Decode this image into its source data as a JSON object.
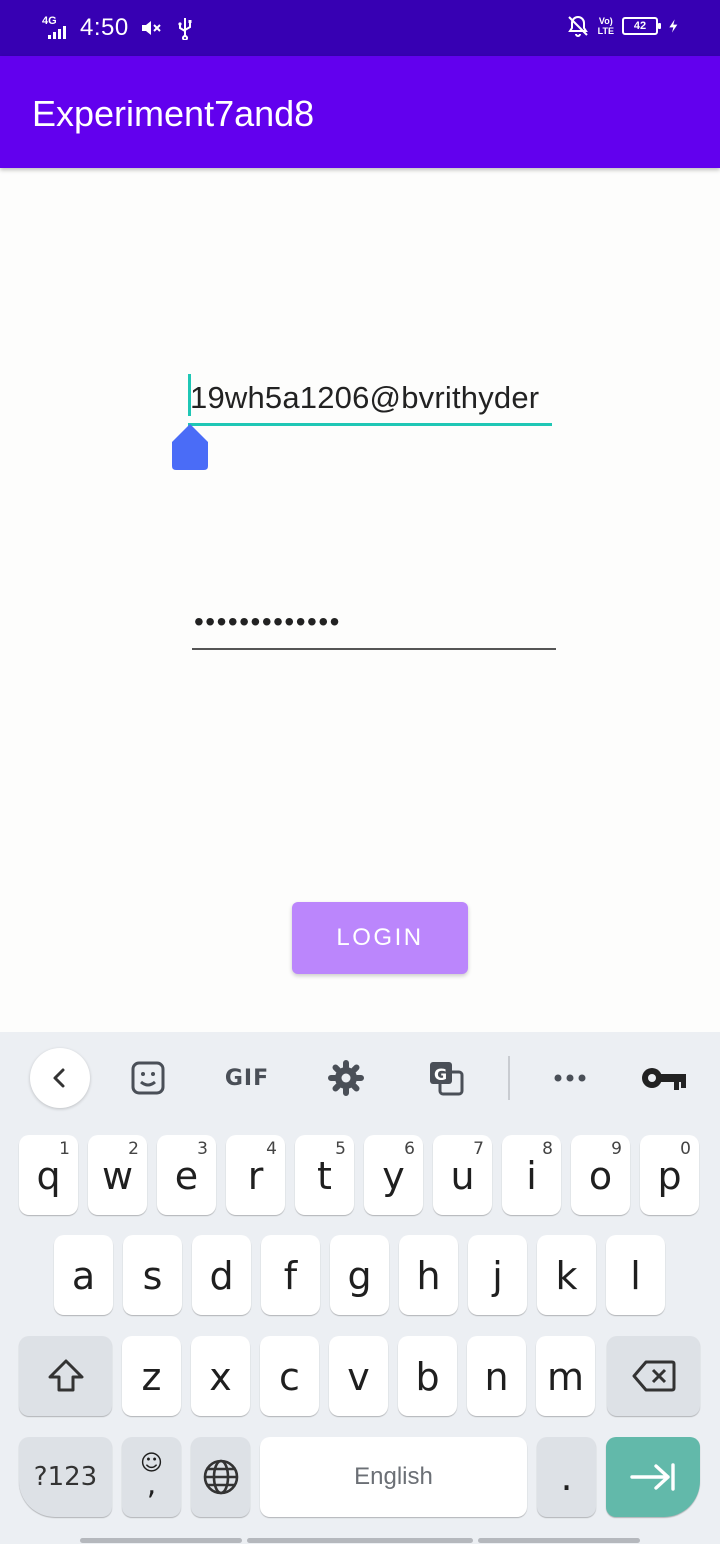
{
  "status_bar": {
    "network_type": "4G",
    "time": "4:50",
    "battery_level": "42",
    "volte_label_top": "Vo)",
    "volte_label_bottom": "LTE"
  },
  "app_bar": {
    "title": "Experiment7and8"
  },
  "form": {
    "email_value": "19wh5a1206@bvrithyder",
    "password_value": "•••••••••••••",
    "login_label": "LOGIN"
  },
  "keyboard": {
    "toolbar": [
      "back",
      "sticker",
      "GIF",
      "settings",
      "translate",
      "more",
      "password"
    ],
    "gif_label": "GIF",
    "row1": [
      {
        "k": "q",
        "h": "1"
      },
      {
        "k": "w",
        "h": "2"
      },
      {
        "k": "e",
        "h": "3"
      },
      {
        "k": "r",
        "h": "4"
      },
      {
        "k": "t",
        "h": "5"
      },
      {
        "k": "y",
        "h": "6"
      },
      {
        "k": "u",
        "h": "7"
      },
      {
        "k": "i",
        "h": "8"
      },
      {
        "k": "o",
        "h": "9"
      },
      {
        "k": "p",
        "h": "0"
      }
    ],
    "row2": [
      "a",
      "s",
      "d",
      "f",
      "g",
      "h",
      "j",
      "k",
      "l"
    ],
    "row3": [
      "z",
      "x",
      "c",
      "v",
      "b",
      "n",
      "m"
    ],
    "symbols_label": "?123",
    "comma_label": ",",
    "space_label": "English",
    "period_label": "."
  },
  "colors": {
    "status_bar": "#3700b3",
    "app_bar": "#6200ee",
    "accent": "#1fc7b5",
    "button": "#bb86fc",
    "handle": "#4a6cf7",
    "enter_key": "#62b9aa"
  }
}
